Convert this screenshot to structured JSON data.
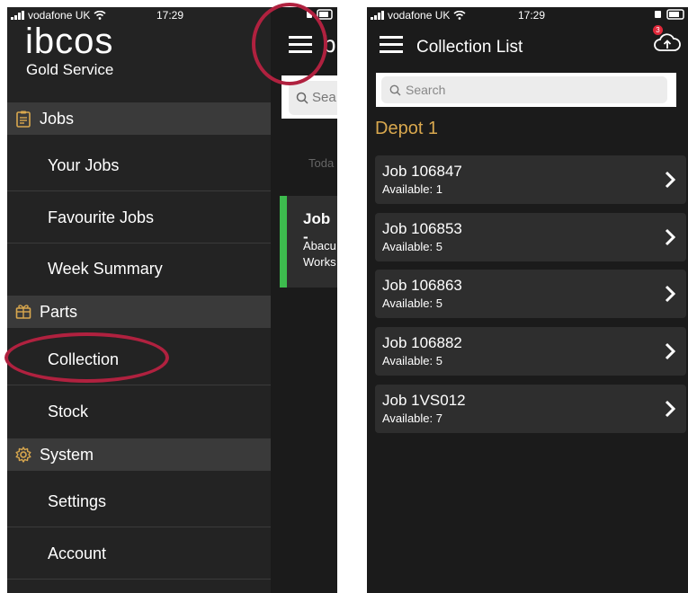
{
  "left": {
    "status": {
      "carrier": "vodafone UK",
      "time": "17:29"
    },
    "logo": "ibcos",
    "subtitle": "Gold Service",
    "sections": [
      {
        "label": "Jobs",
        "items": [
          "Your Jobs",
          "Favourite Jobs",
          "Week Summary"
        ]
      },
      {
        "label": "Parts",
        "items": [
          "Collection",
          "Stock"
        ]
      },
      {
        "label": "System",
        "items": [
          "Settings",
          "Account"
        ]
      }
    ],
    "peek": {
      "title_fragment": "b",
      "search_fragment": "Sea",
      "today_fragment": "Toda",
      "job_title_fragment": "Job -",
      "job_line1_fragment": "Abacu",
      "job_line2_fragment": "Works"
    }
  },
  "right": {
    "status": {
      "carrier": "vodafone UK",
      "time": "17:29"
    },
    "title": "Collection List",
    "upload_badge": "3",
    "search_placeholder": "Search",
    "depot": "Depot 1",
    "jobs": [
      {
        "title": "Job 106847",
        "available": "Available: 1"
      },
      {
        "title": "Job 106853",
        "available": "Available: 5"
      },
      {
        "title": "Job 106863",
        "available": "Available: 5"
      },
      {
        "title": "Job 106882",
        "available": "Available: 5"
      },
      {
        "title": "Job 1VS012",
        "available": "Available: 7"
      }
    ]
  },
  "colors": {
    "accent_gold": "#d9a84e",
    "highlight_circle": "#b0213f",
    "badge_red": "#e0283a",
    "job_stripe_green": "#3dbb4e"
  }
}
